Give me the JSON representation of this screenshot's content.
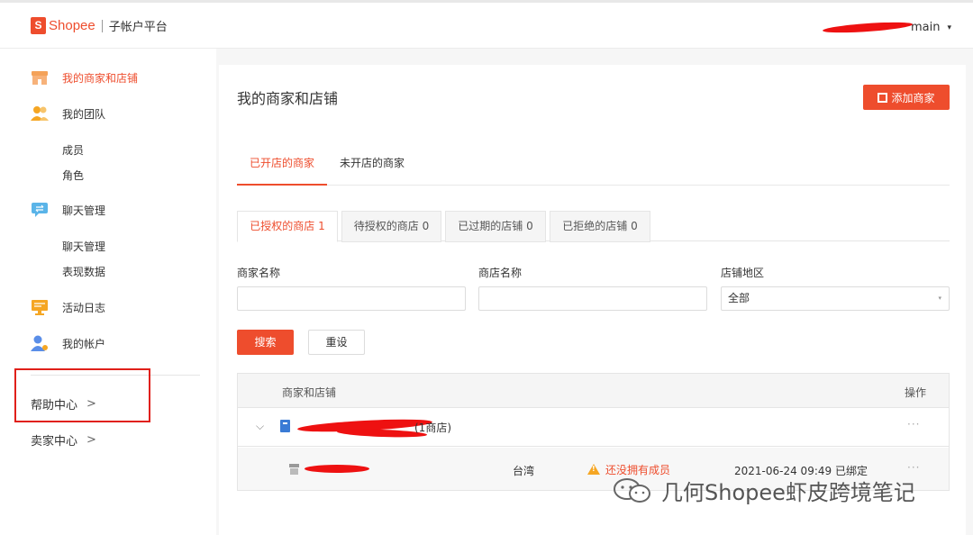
{
  "header": {
    "logo_glyph": "S",
    "logo_text": "Shopee",
    "platform_title": "子帐户平台",
    "username_suffix": "main",
    "user_caret": "▾"
  },
  "sidebar": {
    "items": [
      {
        "label": "我的商家和店铺",
        "icon": "store-icon",
        "active": true
      },
      {
        "label": "我的团队",
        "icon": "team-icon",
        "children": [
          "成员",
          "角色"
        ]
      },
      {
        "label": "聊天管理",
        "icon": "chat-icon",
        "children": [
          "聊天管理",
          "表现数据"
        ]
      },
      {
        "label": "活动日志",
        "icon": "log-icon"
      },
      {
        "label": "我的帐户",
        "icon": "account-icon"
      }
    ],
    "links": [
      {
        "label": "帮助中心",
        "chevron": ">"
      },
      {
        "label": "卖家中心",
        "chevron": ">"
      }
    ]
  },
  "main": {
    "title": "我的商家和店铺",
    "add_button": "添加商家",
    "tabs": [
      "已开店的商家",
      "未开店的商家"
    ],
    "subtabs": [
      "已授权的商店 1",
      "待授权的商店 0",
      "已过期的店铺 0",
      "已拒绝的店铺 0"
    ],
    "filters": {
      "merchant_label": "商家名称",
      "shop_label": "商店名称",
      "region_label": "店铺地区",
      "region_value": "全部",
      "region_caret": "▾"
    },
    "search_button": "搜索",
    "reset_button": "重设",
    "table": {
      "headers": [
        "商家和店铺",
        "操作"
      ],
      "merchant_row": {
        "expand_icon": "⌵",
        "shop_count": "(1商店)",
        "ops": "···"
      },
      "shop_row": {
        "region": "台湾",
        "warning": "还没拥有成员",
        "bound_at": "2021-06-24 09:49 已绑定",
        "ops": "···"
      }
    }
  },
  "watermark": {
    "text": "几何Shopee虾皮跨境笔记"
  },
  "colors": {
    "brand": "#ee4d2d",
    "warning": "#f5a623",
    "warning_text": "#ee4d2d"
  }
}
